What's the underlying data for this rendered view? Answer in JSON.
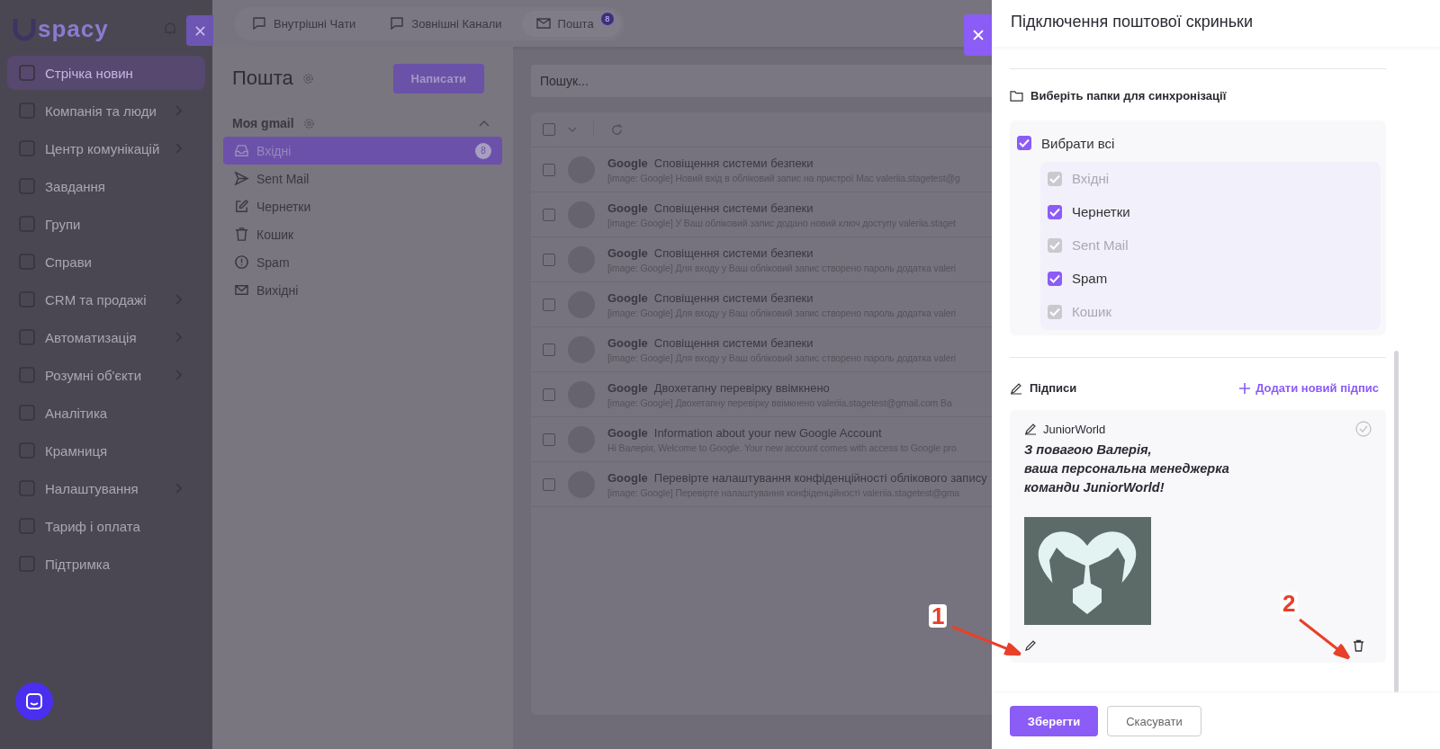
{
  "sidebar": {
    "logo": "spacy",
    "items": [
      {
        "label": "Стрічка новин",
        "selected": true,
        "has_submenu": false
      },
      {
        "label": "Компанія та люди",
        "selected": false,
        "has_submenu": true
      },
      {
        "label": "Центр комунікацій",
        "selected": false,
        "has_submenu": true
      },
      {
        "label": "Завдання",
        "selected": false,
        "has_submenu": false
      },
      {
        "label": "Групи",
        "selected": false,
        "has_submenu": false
      },
      {
        "label": "Справи",
        "selected": false,
        "has_submenu": false
      },
      {
        "label": "CRM та продажі",
        "selected": false,
        "has_submenu": true
      },
      {
        "label": "Автоматизація",
        "selected": false,
        "has_submenu": true
      },
      {
        "label": "Розумні об'єкти",
        "selected": false,
        "has_submenu": true
      },
      {
        "label": "Аналітика",
        "selected": false,
        "has_submenu": false
      },
      {
        "label": "Крамниця",
        "selected": false,
        "has_submenu": false
      },
      {
        "label": "Налаштування",
        "selected": false,
        "has_submenu": true
      },
      {
        "label": "Тариф і оплата",
        "selected": false,
        "has_submenu": false
      },
      {
        "label": "Підтримка",
        "selected": false,
        "has_submenu": false
      }
    ]
  },
  "top_tabs": [
    {
      "label": "Внутрішні Чати",
      "selected": false
    },
    {
      "label": "Зовнішні Канали",
      "selected": false
    },
    {
      "label": "Пошта",
      "selected": true,
      "badge": "8"
    }
  ],
  "mail_panel": {
    "title": "Пошта",
    "compose_button": "Написати",
    "account": {
      "name": "Моя gmail",
      "expanded": true
    },
    "folders": [
      {
        "label": "Вхідні",
        "selected": true,
        "badge": "8"
      },
      {
        "label": "Sent Mail",
        "selected": false
      },
      {
        "label": "Чернетки",
        "selected": false
      },
      {
        "label": "Кошик",
        "selected": false
      },
      {
        "label": "Spam",
        "selected": false
      },
      {
        "label": "Вихідні",
        "selected": false
      }
    ]
  },
  "search": {
    "placeholder": "Пошук..."
  },
  "list_header": {
    "select_all_checked": false
  },
  "messages": [
    {
      "sender": "Google",
      "subject": "Сповіщення системи безпеки",
      "preview": "[image: Google] Новий вхід в обліковий запис на пристрої Mac valeriia.stagetest@g",
      "checked": false
    },
    {
      "sender": "Google",
      "subject": "Сповіщення системи безпеки",
      "preview": "[image: Google] У Ваш обліковий запис додано новий ключ доступу valeriia.staget",
      "checked": false
    },
    {
      "sender": "Google",
      "subject": "Сповіщення системи безпеки",
      "preview": "[image: Google] Для входу у Ваш обліковий запис створено пароль додатка valeri",
      "checked": false
    },
    {
      "sender": "Google",
      "subject": "Сповіщення системи безпеки",
      "preview": "[image: Google] Для входу у Ваш обліковий запис створено пароль додатка valeri",
      "checked": false
    },
    {
      "sender": "Google",
      "subject": "Сповіщення системи безпеки",
      "preview": "[image: Google] Для входу у Ваш обліковий запис створено пароль додатка valeri",
      "checked": false
    },
    {
      "sender": "Google",
      "subject": "Двохетапну перевірку ввімкнено",
      "preview": "[image: Google] Двохетапну перевірку ввімкнено valeriia.stagetest@gmail.com Ва",
      "checked": false
    },
    {
      "sender": "Google",
      "subject": "Information about your new Google Account",
      "preview": "Hi Валерія, Welcome to Google. Your new account comes with access to Google pro",
      "checked": false
    },
    {
      "sender": "Google",
      "subject": "Перевірте налаштування конфіденційності облікового запису",
      "preview": "[image: Google] Перевірте налаштування конфіденційності valeriia.stagetest@gma",
      "checked": false
    }
  ],
  "drawer": {
    "title": "Підключення поштової скриньки",
    "folders_section": {
      "title": "Виберіть папки для синхронізації",
      "select_all": {
        "label": "Вибрати всі",
        "checked": true
      },
      "folders": [
        {
          "label": "Вхідні",
          "checked": true,
          "disabled": true
        },
        {
          "label": "Чернетки",
          "checked": true,
          "disabled": false
        },
        {
          "label": "Sent Mail",
          "checked": true,
          "disabled": true
        },
        {
          "label": "Spam",
          "checked": true,
          "disabled": false
        },
        {
          "label": "Кошик",
          "checked": true,
          "disabled": true
        }
      ]
    },
    "signatures": {
      "title": "Підписи",
      "add_link": "Додати новий підпис",
      "items": [
        {
          "name": "JuniorWorld",
          "lines": [
            "З повагою Валерія,",
            "ваша персональна менеджерка",
            "команди JuniorWorld!"
          ]
        }
      ]
    },
    "buttons": {
      "save": "Зберегти",
      "cancel": "Скасувати"
    }
  },
  "annotations": [
    {
      "label": "1"
    },
    {
      "label": "2"
    }
  ]
}
